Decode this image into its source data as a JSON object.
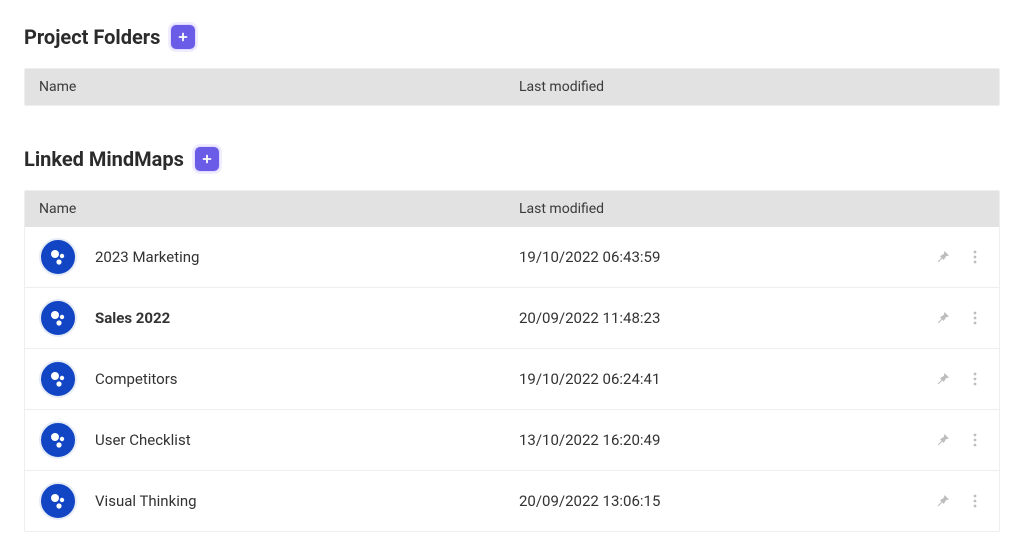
{
  "sections": {
    "folders": {
      "title": "Project Folders",
      "columns": {
        "name": "Name",
        "modified": "Last modified"
      },
      "rows": []
    },
    "mindmaps": {
      "title": "Linked MindMaps",
      "columns": {
        "name": "Name",
        "modified": "Last modified"
      },
      "rows": [
        {
          "name": "2023 Marketing",
          "modified": "19/10/2022 06:43:59",
          "bold": false
        },
        {
          "name": "Sales 2022",
          "modified": "20/09/2022 11:48:23",
          "bold": true
        },
        {
          "name": "Competitors",
          "modified": "19/10/2022 06:24:41",
          "bold": false
        },
        {
          "name": "User Checklist",
          "modified": "13/10/2022 16:20:49",
          "bold": false
        },
        {
          "name": "Visual Thinking",
          "modified": "20/09/2022 13:06:15",
          "bold": false
        }
      ]
    }
  }
}
